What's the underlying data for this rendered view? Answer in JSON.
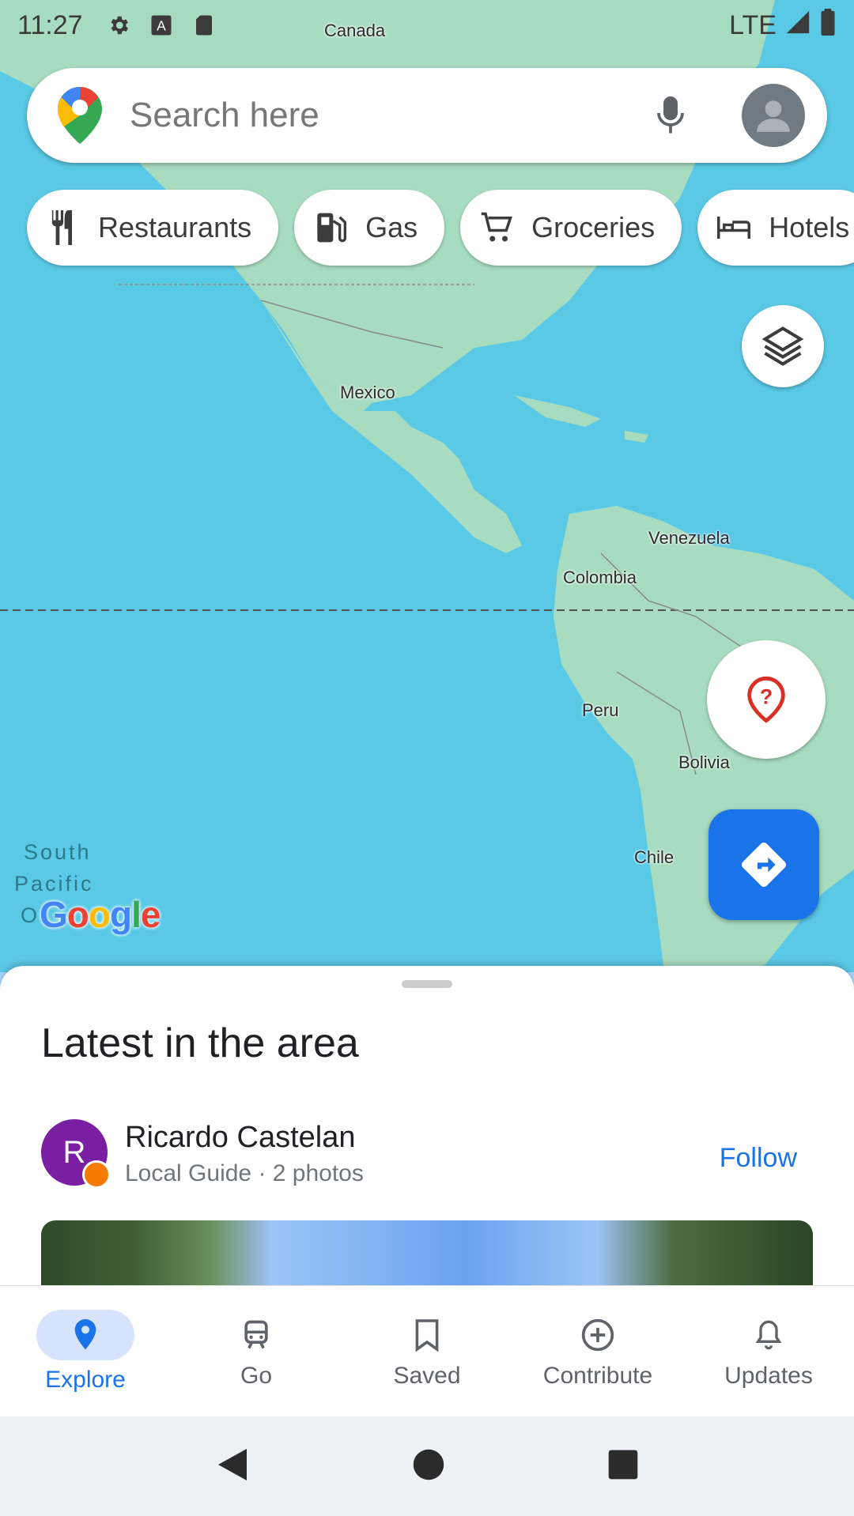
{
  "status_bar": {
    "time": "11:27",
    "network": "LTE"
  },
  "map": {
    "labels": {
      "canada": "Canada",
      "mexico": "Mexico",
      "venezuela": "Venezuela",
      "colombia": "Colombia",
      "peru": "Peru",
      "bolivia": "Bolivia",
      "chile": "Chile"
    },
    "ocean_lines": [
      "South",
      "Pacific",
      "O"
    ],
    "attribution": "Google"
  },
  "search": {
    "placeholder": "Search here"
  },
  "chips": [
    {
      "label": "Restaurants",
      "icon": "fork-knife-icon"
    },
    {
      "label": "Gas",
      "icon": "gas-pump-icon"
    },
    {
      "label": "Groceries",
      "icon": "cart-icon"
    },
    {
      "label": "Hotels",
      "icon": "bed-icon"
    }
  ],
  "sheet": {
    "title": "Latest in the area",
    "post": {
      "avatar_initial": "R",
      "author": "Ricardo Castelan",
      "subtitle": "Local Guide · 2 photos",
      "follow_label": "Follow"
    }
  },
  "bottom_nav": [
    {
      "label": "Explore",
      "icon": "explore-pin-icon",
      "active": true
    },
    {
      "label": "Go",
      "icon": "commute-icon",
      "active": false
    },
    {
      "label": "Saved",
      "icon": "bookmark-icon",
      "active": false
    },
    {
      "label": "Contribute",
      "icon": "add-circle-icon",
      "active": false
    },
    {
      "label": "Updates",
      "icon": "bell-icon",
      "active": false
    }
  ],
  "colors": {
    "accent": "#1a73e8",
    "ocean": "#5ac9e6",
    "land": "#a8dcc0"
  }
}
